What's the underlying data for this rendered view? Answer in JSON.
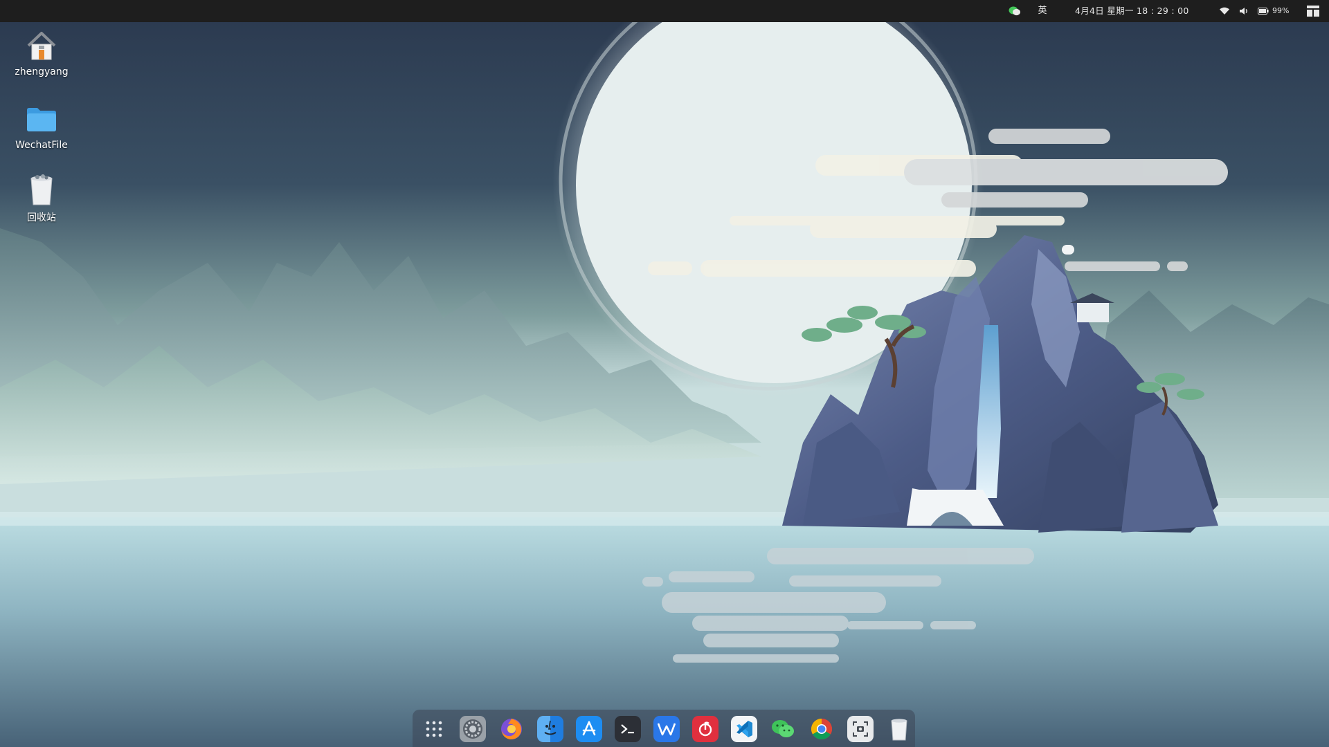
{
  "topbar": {
    "ime_label": "英",
    "clock": "4月4日 星期一 18 : 29 : 00",
    "battery_percent": "99%",
    "icons": [
      "wechat-tray-icon",
      "wifi-icon",
      "volume-icon",
      "battery-icon",
      "layout-icon"
    ]
  },
  "desktop": {
    "icons": [
      {
        "label": "zhengyang",
        "icon": "home-folder-icon"
      },
      {
        "label": "WechatFile",
        "icon": "folder-icon"
      },
      {
        "label": "回收站",
        "icon": "trash-icon"
      }
    ]
  },
  "dock": {
    "items": [
      {
        "name": "app-launcher",
        "icon": "grid-icon"
      },
      {
        "name": "system-settings",
        "icon": "settings-icon"
      },
      {
        "name": "firefox",
        "icon": "firefox-icon"
      },
      {
        "name": "file-manager",
        "icon": "finder-icon"
      },
      {
        "name": "app-store",
        "icon": "app-store-icon"
      },
      {
        "name": "terminal",
        "icon": "terminal-icon"
      },
      {
        "name": "wps-office",
        "icon": "wps-icon"
      },
      {
        "name": "netease-music",
        "icon": "netease-music-icon"
      },
      {
        "name": "vscode",
        "icon": "vscode-icon"
      },
      {
        "name": "wechat",
        "icon": "wechat-icon"
      },
      {
        "name": "chrome",
        "icon": "chrome-icon"
      },
      {
        "name": "screenshot",
        "icon": "screenshot-icon"
      },
      {
        "name": "trash",
        "icon": "trash-icon"
      }
    ]
  },
  "colors": {
    "topbar_bg": "#1e1e1e",
    "sky_top": "#2c3b52",
    "moon": "#e9f0f0",
    "water": "#a9cdd6"
  }
}
